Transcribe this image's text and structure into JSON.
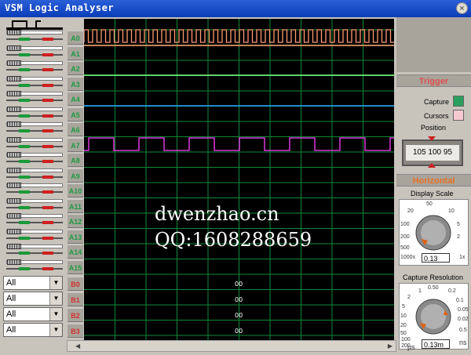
{
  "window": {
    "title": "VSM Logic Analyser",
    "close": "×"
  },
  "channels": [
    "A0",
    "A1",
    "A2",
    "A3",
    "A4",
    "A5",
    "A6",
    "A7",
    "A8",
    "A9",
    "A10",
    "A11",
    "A12",
    "A13",
    "A14",
    "A15"
  ],
  "buses": [
    {
      "label": "B0",
      "select": "All",
      "value": "00"
    },
    {
      "label": "B1",
      "select": "All",
      "value": "00"
    },
    {
      "label": "B2",
      "select": "All",
      "value": "00"
    },
    {
      "label": "B3",
      "select": "All",
      "value": "00"
    }
  ],
  "trigger": {
    "header": "Trigger",
    "capture_label": "Capture",
    "cursors_label": "Cursors",
    "position_label": "Position",
    "position_readout": "105 100 95"
  },
  "horizontal": {
    "header": "Horizontal",
    "display_scale": {
      "label": "Display Scale",
      "value": "0.13",
      "ticks": [
        "50",
        "20",
        "10",
        "100",
        "5",
        "200",
        "2",
        "500",
        "1000x",
        "1x"
      ]
    },
    "capture_resolution": {
      "label": "Capture Resolution",
      "value": "0.13m",
      "ticks": [
        "0.50",
        "0.2",
        "0.1",
        "1",
        "2",
        "0.05",
        "5",
        "0.02",
        "10",
        "20",
        "50",
        "0.5",
        "100",
        "200",
        "µs",
        "ns"
      ]
    }
  },
  "watermark": {
    "line1": "dwenzhao.cn",
    "line2": "QQ:1608288659"
  },
  "colors": {
    "a0": "#ff9a70",
    "a2": "#7aff7a",
    "a4": "#2aa0ff",
    "a7": "#ff40ff",
    "grid": "#0e8a3a",
    "trigger_text": "#e05050",
    "horizontal_text": "#e87020"
  }
}
